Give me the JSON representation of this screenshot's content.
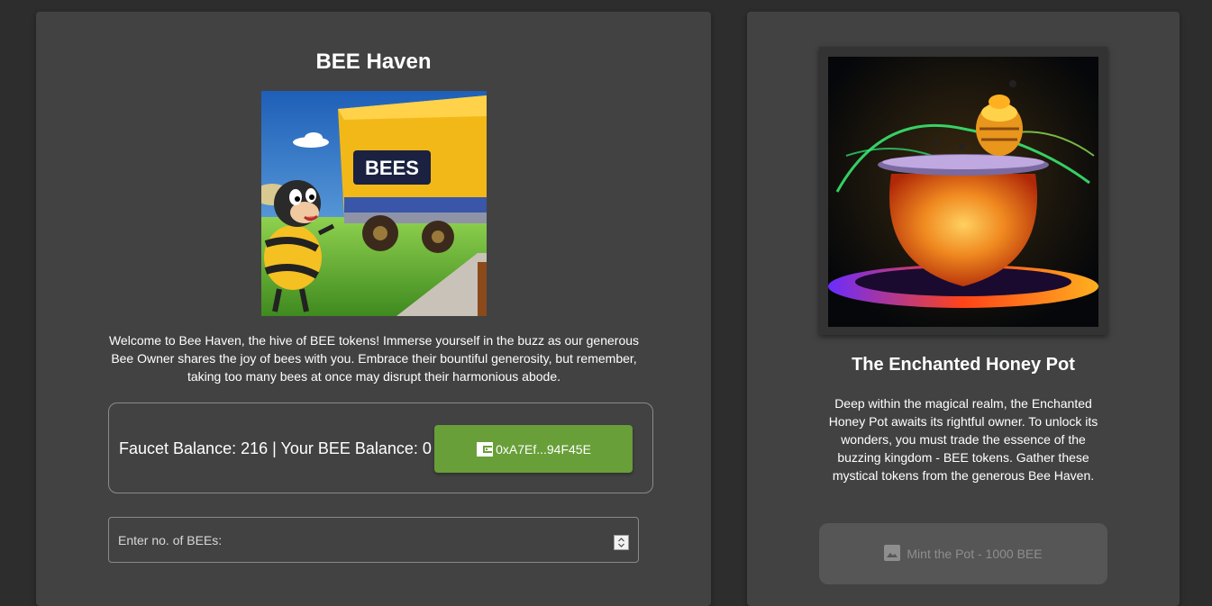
{
  "faucet_card": {
    "title": "BEE Haven",
    "image_text": "BEES",
    "description": "Welcome to Bee Haven, the hive of BEE tokens! Immerse yourself in the buzz as our generous Bee Owner shares the joy of bees with you. Embrace their bountiful generosity, but remember, taking too many bees at once may disrupt their harmonious abode.",
    "balance_text": "Faucet Balance: 216 | Your BEE Balance: 0",
    "faucet_balance": 216,
    "user_balance": 0,
    "wallet_button_label": "0xA7Ef...94F45E",
    "wallet_icon": "wallet-icon",
    "amount_placeholder": "Enter no. of BEEs:"
  },
  "nft_card": {
    "title": "The Enchanted Honey Pot",
    "description": "Deep within the magical realm, the Enchanted Honey Pot awaits its rightful owner. To unlock its wonders, you must trade the essence of the buzzing kingdom - BEE tokens. Gather these mystical tokens from the generous Bee Haven.",
    "mint_button_label": "Mint the Pot - 1000 BEE",
    "mint_icon": "image-icon"
  },
  "colors": {
    "background": "#2d2d2d",
    "card": "#424242",
    "wallet_button": "#689f38",
    "mint_button_disabled": "#565656"
  }
}
